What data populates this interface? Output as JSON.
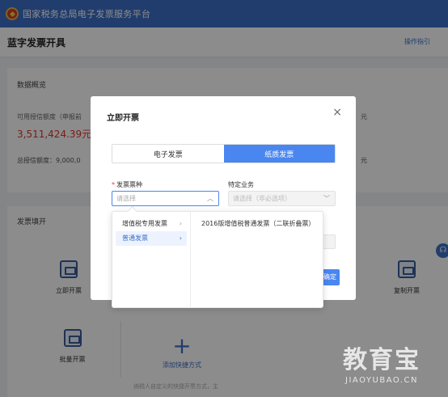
{
  "app": {
    "title": "国家税务总局电子发票服务平台"
  },
  "page": {
    "title": "蓝字发票开具",
    "guide_link": "操作指引"
  },
  "overview": {
    "title": "数据概览",
    "credit_available_label": "可用授信额度（申报前",
    "credit_available_value": "3,511,424.39元",
    "credit_total_label": "总授信额度：9,000,0",
    "side_text_1": "元",
    "side_text_2": "元"
  },
  "invoice_section": {
    "title": "发票填开",
    "cards": {
      "instant": "立即开票",
      "copy": "复制开票",
      "batch": "批量开票",
      "add_quick": "添加快捷方式"
    },
    "hint": "纳税人自定义的快捷开票方式，主"
  },
  "modal": {
    "title": "立即开票",
    "close_icon": "close-icon",
    "tabs": [
      {
        "label": "电子发票",
        "active": false
      },
      {
        "label": "纸质发票",
        "active": true
      }
    ],
    "fields": {
      "invoice_type": {
        "required_mark": "*",
        "label": "发票票种",
        "placeholder": "请选择"
      },
      "special_business": {
        "label": "特定业务",
        "placeholder": "请选择（非必选项）"
      }
    },
    "confirm_label": "确定"
  },
  "cascader": {
    "level1": [
      {
        "label": "增值税专用发票",
        "active": false
      },
      {
        "label": "普通发票",
        "active": true
      }
    ],
    "level2": [
      {
        "label": "2016版增值税普通发票（二联折叠票）"
      }
    ]
  },
  "help_icon": "headset-icon",
  "watermark": {
    "cn": "教育宝",
    "en": "JIAOYUBAO.CN"
  },
  "colors": {
    "header_blue": "#3c6fc7",
    "accent_blue": "#4a86f0",
    "amount_red": "#d9372c"
  }
}
